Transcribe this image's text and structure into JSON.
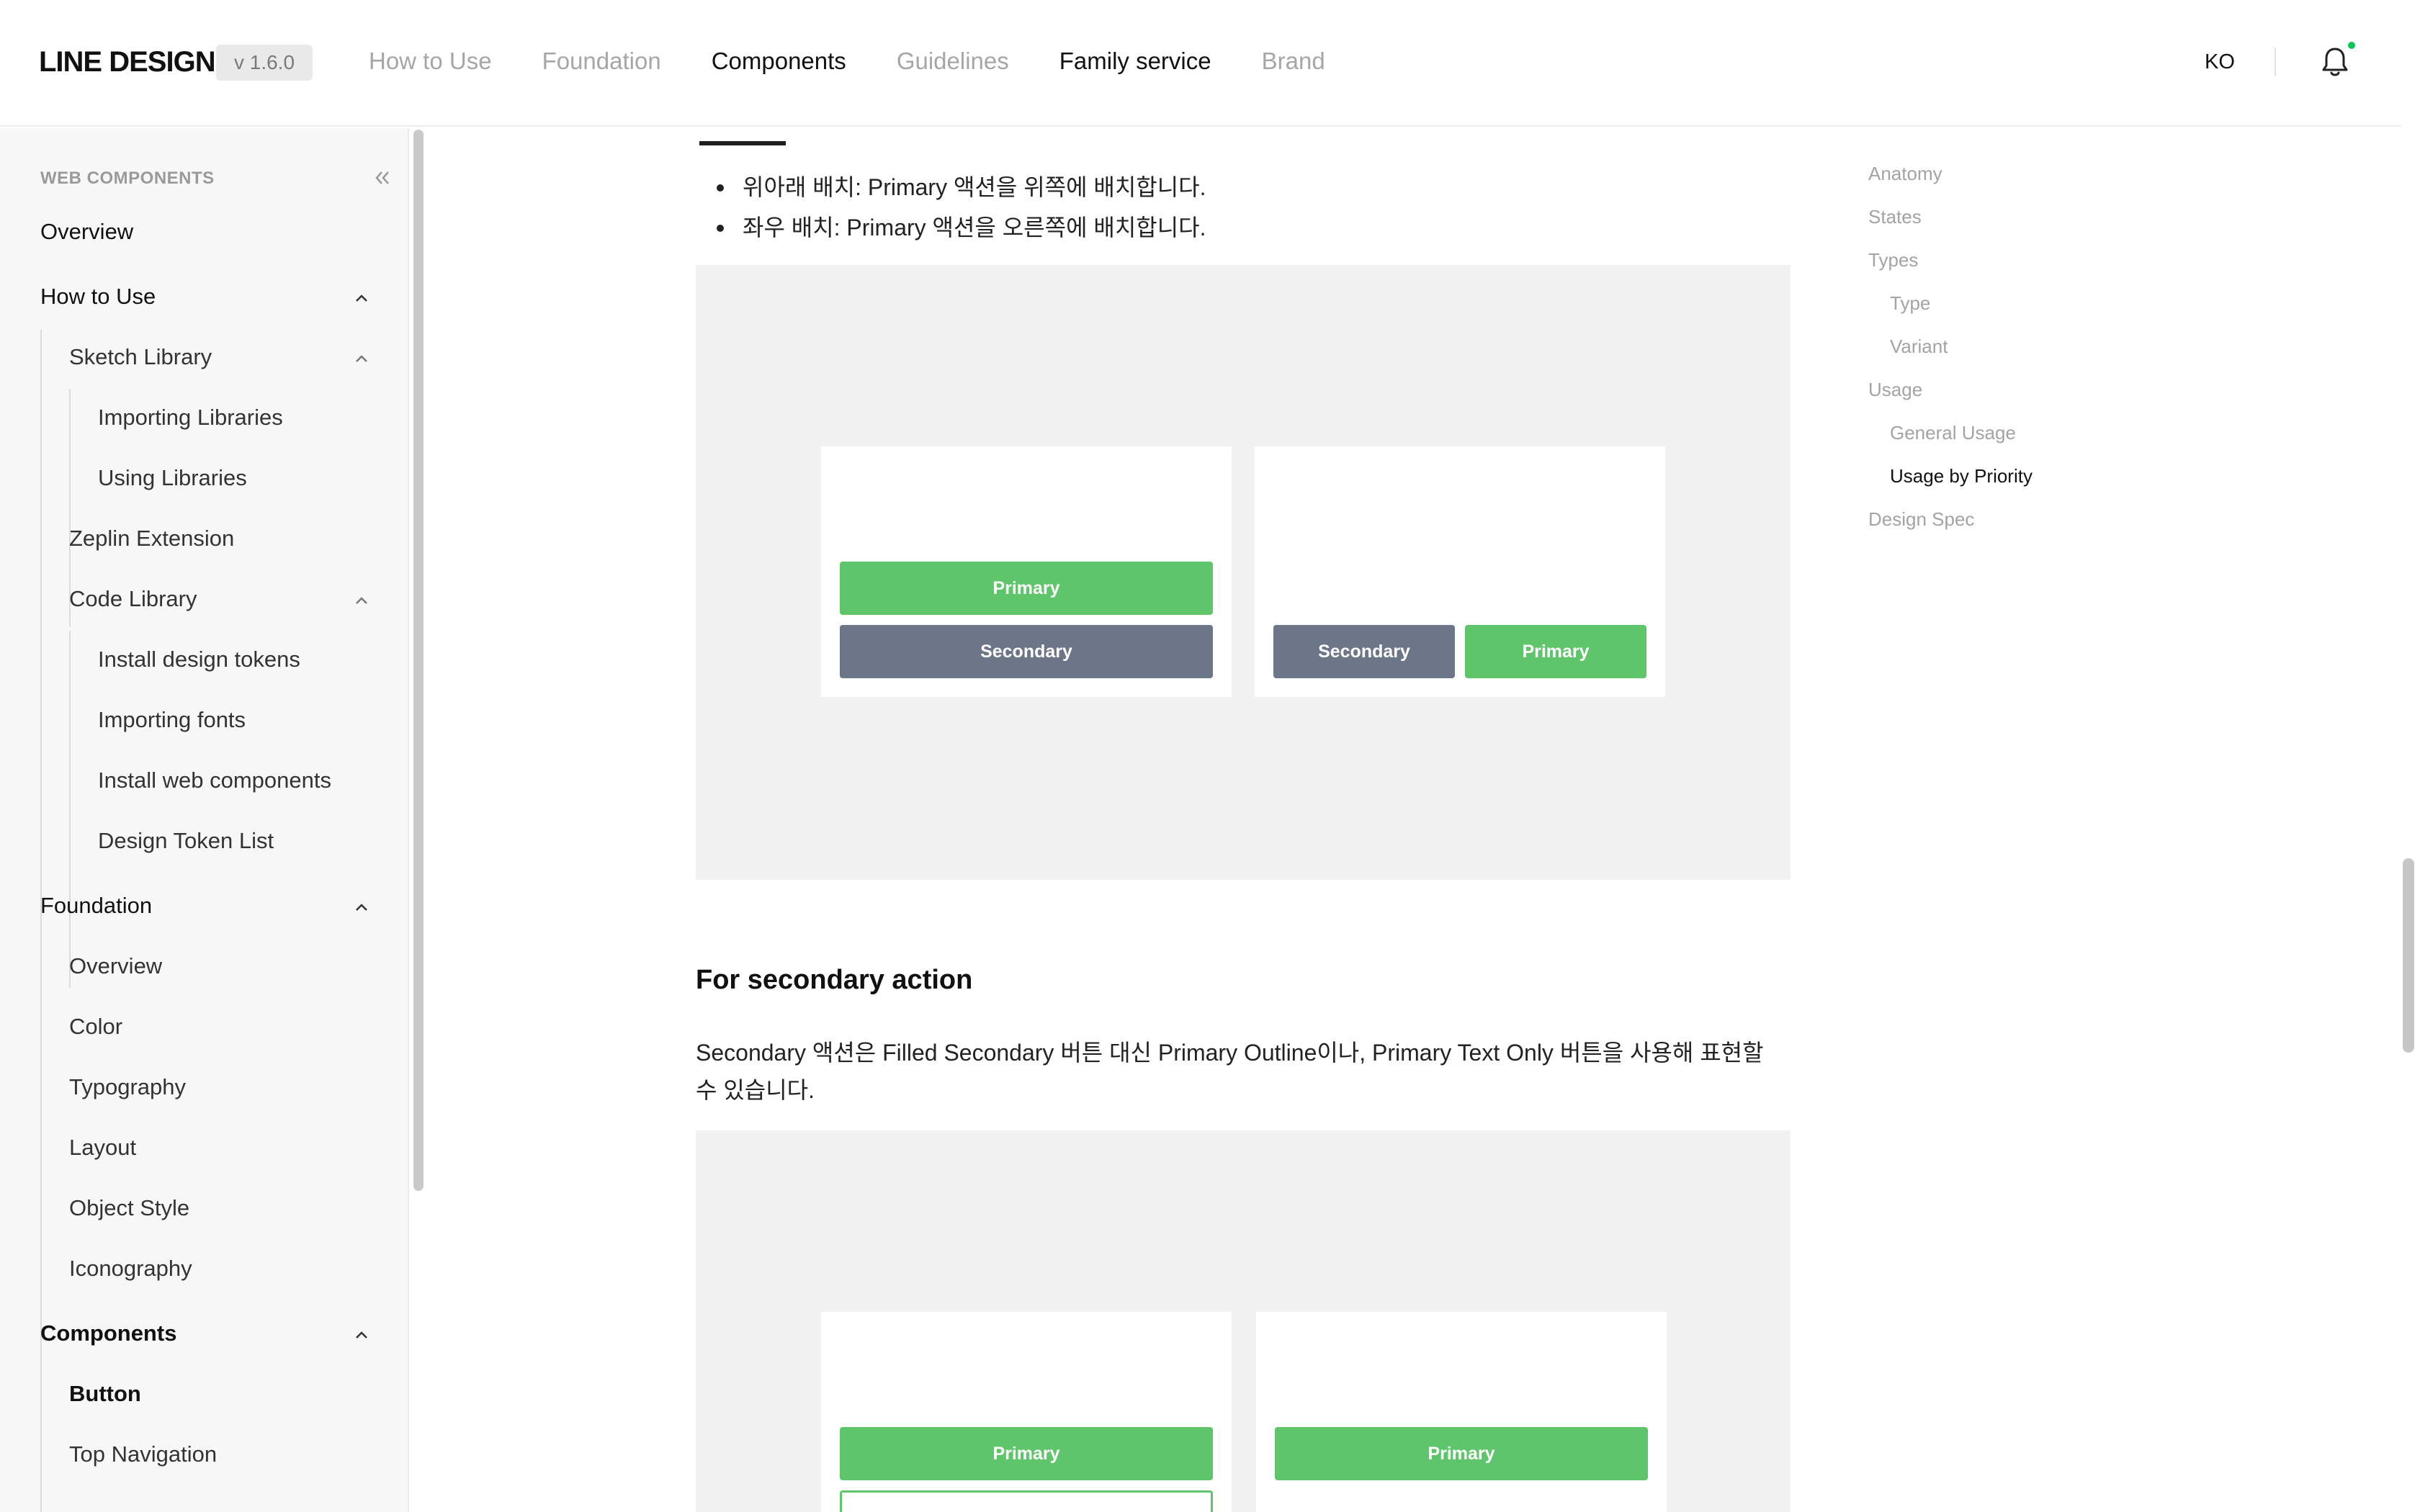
{
  "header": {
    "logo": "LINE DESIGN",
    "version": "v 1.6.0",
    "nav": [
      {
        "label": "How to Use"
      },
      {
        "label": "Foundation"
      },
      {
        "label": "Components"
      },
      {
        "label": "Guidelines"
      },
      {
        "label": "Family service"
      },
      {
        "label": "Brand"
      }
    ],
    "lang": "KO",
    "notification_icon": "bell-icon",
    "notification_dot_color": "#06c755"
  },
  "sidebar": {
    "section_title": "WEB COMPONENTS",
    "collapse_icon": "double-chevron-left-icon",
    "items": [
      {
        "label": "Overview"
      },
      {
        "label": "How to Use"
      },
      {
        "label": "Sketch Library"
      },
      {
        "label": "Importing Libraries"
      },
      {
        "label": "Using Libraries"
      },
      {
        "label": "Zeplin Extension"
      },
      {
        "label": "Code Library"
      },
      {
        "label": "Install design tokens"
      },
      {
        "label": "Importing fonts"
      },
      {
        "label": "Install web components"
      },
      {
        "label": "Design Token List"
      },
      {
        "label": "Foundation"
      },
      {
        "label": "Overview"
      },
      {
        "label": "Color"
      },
      {
        "label": "Typography"
      },
      {
        "label": "Layout"
      },
      {
        "label": "Object Style"
      },
      {
        "label": "Iconography"
      },
      {
        "label": "Components"
      },
      {
        "label": "Button"
      },
      {
        "label": "Top Navigation"
      }
    ]
  },
  "main": {
    "bullets": [
      "위아래 배치: Primary 액션을 위쪽에 배치합니다.",
      "좌우 배치: Primary 액션을 오른쪽에 배치합니다."
    ],
    "demo1": {
      "vertical": {
        "top": "Primary",
        "bottom": "Secondary"
      },
      "horizontal": {
        "left": "Secondary",
        "right": "Primary"
      }
    },
    "section_title": "For secondary action",
    "section_text": "Secondary 액션은 Filled Secondary 버튼 대신 Primary Outline이나, Primary Text Only 버튼을 사용해 표현할 수 있습니다.",
    "demo2": {
      "left_primary": "Primary",
      "right_primary": "Primary"
    },
    "colors": {
      "primary": "#5fc56a",
      "secondary": "#6d7589"
    }
  },
  "toc": {
    "items": [
      {
        "label": "Anatomy"
      },
      {
        "label": "States"
      },
      {
        "label": "Types"
      },
      {
        "label": "Type"
      },
      {
        "label": "Variant"
      },
      {
        "label": "Usage"
      },
      {
        "label": "General Usage"
      },
      {
        "label": "Usage by Priority"
      },
      {
        "label": "Design Spec"
      }
    ]
  }
}
